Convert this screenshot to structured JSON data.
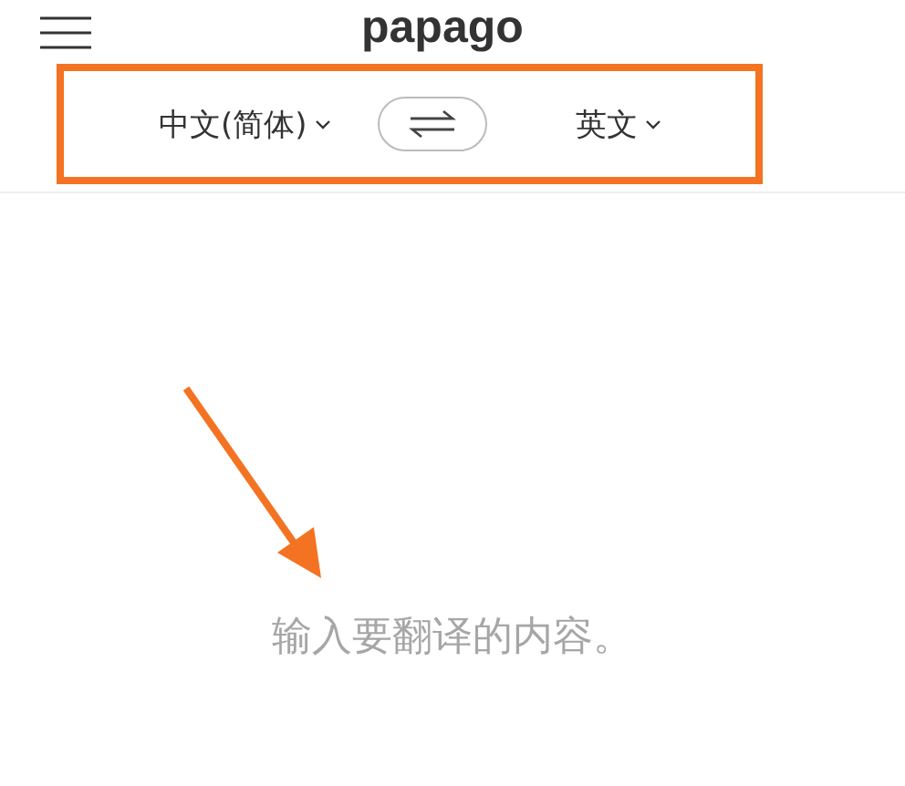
{
  "header": {
    "logo": "papago"
  },
  "languages": {
    "source": "中文(简体)",
    "target": "英文"
  },
  "input": {
    "placeholder": "输入要翻译的内容。"
  }
}
